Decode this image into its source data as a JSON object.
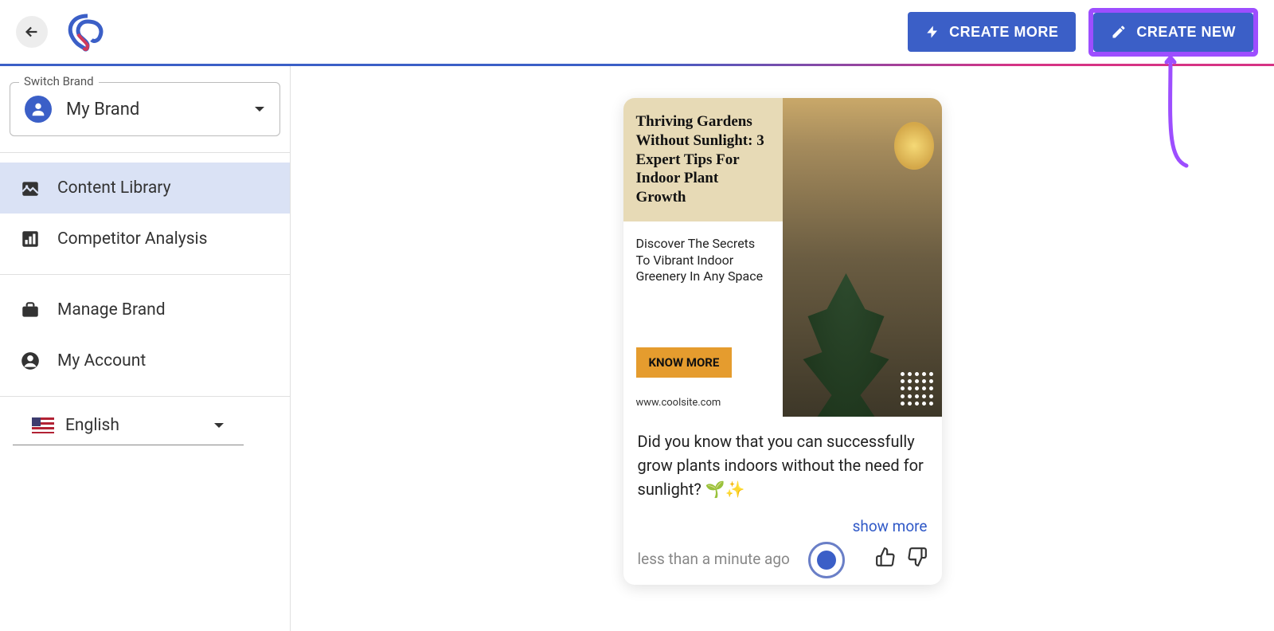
{
  "header": {
    "create_more": "CREATE MORE",
    "create_new": "CREATE NEW"
  },
  "sidebar": {
    "switch_brand_label": "Switch Brand",
    "brand_name": "My Brand",
    "nav": {
      "content_library": "Content Library",
      "competitor_analysis": "Competitor Analysis",
      "manage_brand": "Manage Brand",
      "my_account": "My Account"
    },
    "language": "English"
  },
  "card": {
    "headline": "Thriving Gardens Without Sunlight: 3 Expert Tips For Indoor Plant Growth",
    "description": "Discover The Secrets To Vibrant Indoor Greenery In Any Space",
    "cta": "KNOW MORE",
    "url": "www.coolsite.com",
    "body": "Did you know that you can successfully grow plants indoors without the need for sunlight? 🌱✨",
    "show_more": "show more",
    "timestamp": "less than a minute ago"
  }
}
